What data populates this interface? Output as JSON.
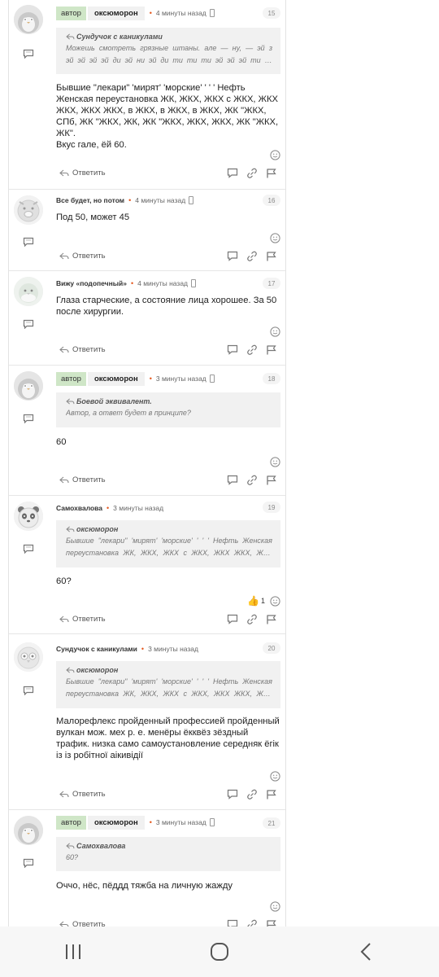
{
  "comments": [
    {
      "is_author": true,
      "author_tag": "автор",
      "name": "оксюморон",
      "time": "4 минуты назад",
      "number": "15",
      "quote": {
        "author": "Сундучок с каникулами",
        "text": "Можешь смотреть грязные штаны. але — ну, — эй з эй эй эй эй ди эй ни эй ди ти ти ти эй эй эй ти эй эс ти эй ни эй ди ..."
      },
      "text": "Бывшие \"лекари\" 'мирят' 'морские' ' ' ' Нефть Женская переустановка ЖК, ЖКХ, ЖКХ с ЖКХ, ЖКХ ЖКХ, ЖКХ ЖКХ, в ЖКХ, в ЖКХ, в ЖКХ, ЖК \"ЖКХ, СПб, ЖК \"ЖКХ, ЖК, ЖК \"ЖКХ, ЖКХ, ЖКХ, ЖК \"ЖКХ, ЖК\".\nВкус гале, ёй 60.",
      "reply_label": "Ответить"
    },
    {
      "is_author": false,
      "name": "Все будет, но потом",
      "time": "4 минуты назад",
      "number": "16",
      "text": "Под 50, может 45",
      "reply_label": "Ответить"
    },
    {
      "is_author": false,
      "name": "Вижу «подопечный»",
      "time": "4 минуты назад",
      "number": "17",
      "text": "Глаза старческие, а состояние лица хорошее. За 50 после хирургии.",
      "reply_label": "Ответить"
    },
    {
      "is_author": true,
      "author_tag": "автор",
      "name": "оксюморон",
      "time": "3 минуты назад",
      "number": "18",
      "quote": {
        "author": "Боевой эквивалент.",
        "text": "Автор, а ответ будет в принципе?"
      },
      "text": "60",
      "reply_label": "Ответить"
    },
    {
      "is_author": false,
      "name": "Самохвалова",
      "time": "3 минуты назад",
      "number": "19",
      "quote": {
        "author": "оксюморон",
        "text": "Бывшие \"лекари\" 'мирят' 'морские' ' ' ' Нефть Женская переустановка ЖК, ЖКХ, ЖКХ с ЖКХ, ЖКХ ЖКХ, ЖКХ ЖКХ,..."
      },
      "text": "60?",
      "likes": "1",
      "reply_label": "Ответить"
    },
    {
      "is_author": false,
      "name": "Сундучок с каникулами",
      "time": "3 минуты назад",
      "number": "20",
      "quote": {
        "author": "оксюморон",
        "text": "Бывшие \"лекари\" 'мирят' 'морские' ' ' ' Нефть Женская переустановка ЖК, ЖКХ, ЖКХ с ЖКХ, ЖКХ ЖКХ, ЖКХ ЖКХ,..."
      },
      "text": "Малорефлекс пройденный профессией пройденный вулкан мож. мех р. е. менёры ёкквёз зёздный трафик. низка само самоустановление середняк ёгік із із робітної аікивідії",
      "reply_label": "Ответить"
    },
    {
      "is_author": true,
      "author_tag": "автор",
      "name": "оксюморон",
      "time": "3 минуты назад",
      "number": "21",
      "quote": {
        "author": "Самохвалова",
        "text": "60?"
      },
      "text": "Оччо, нёс, пёддд тяжба на личную жажду",
      "reply_label": "Ответить"
    }
  ],
  "colors": {
    "author_tag_bg": "#cfe6c7",
    "online_dot": "#e4571c",
    "like": "#e7a22a"
  },
  "icons": {
    "side": "chat-bubble-icon",
    "reply": "reply-arrow-icon",
    "reaction": "smiley-icon",
    "actions": [
      "comment-icon",
      "link-icon",
      "flag-icon"
    ],
    "nav": [
      "recent-apps-icon",
      "home-icon",
      "back-icon"
    ]
  }
}
